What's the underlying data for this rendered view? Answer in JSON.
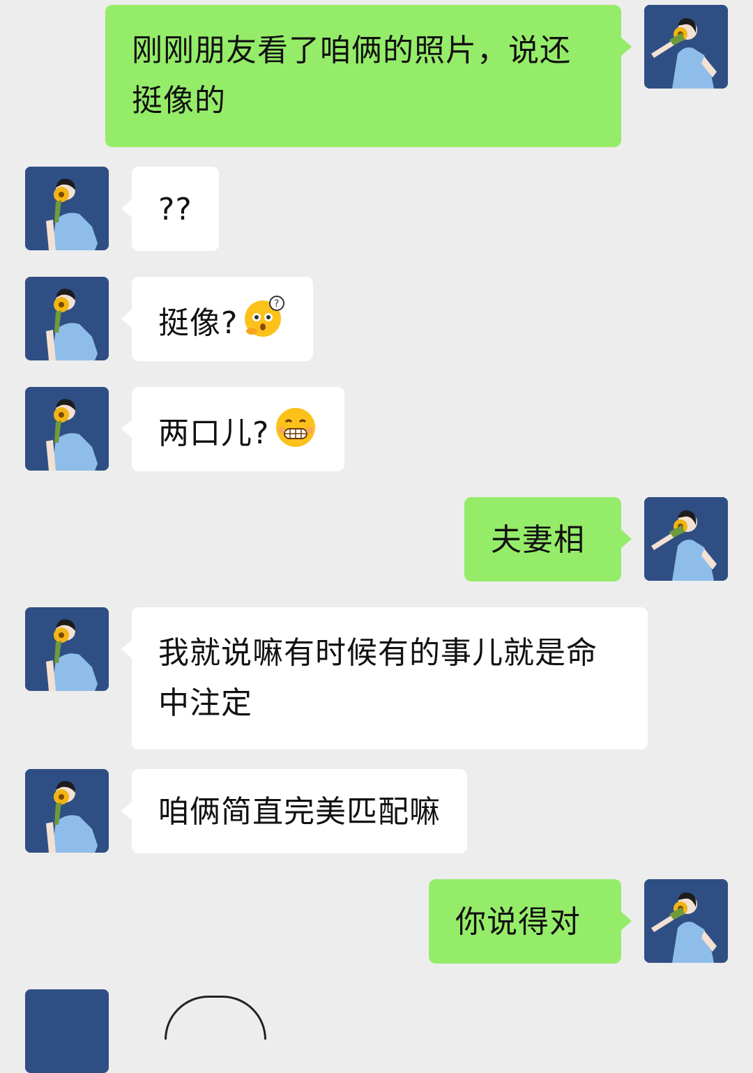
{
  "colors": {
    "background": "#ededed",
    "incoming_bubble": "#ffffff",
    "outgoing_bubble": "#95ec69",
    "avatar_bg": "#2f4f84"
  },
  "messages": [
    {
      "sender": "me",
      "text": "刚刚朋友看了咱俩的照片，说还挺像的"
    },
    {
      "sender": "friend",
      "text": "??"
    },
    {
      "sender": "friend",
      "text": "挺像?",
      "emoji": "shocked-thinking-emoji"
    },
    {
      "sender": "friend",
      "text": "两口儿?",
      "emoji": "grinning-teeth-emoji"
    },
    {
      "sender": "me",
      "text": "夫妻相"
    },
    {
      "sender": "friend",
      "text": "我就说嘛有时候有的事儿就是命中注定"
    },
    {
      "sender": "friend",
      "text": "咱俩简直完美匹配嘛"
    },
    {
      "sender": "me",
      "text": "你说得对"
    }
  ]
}
